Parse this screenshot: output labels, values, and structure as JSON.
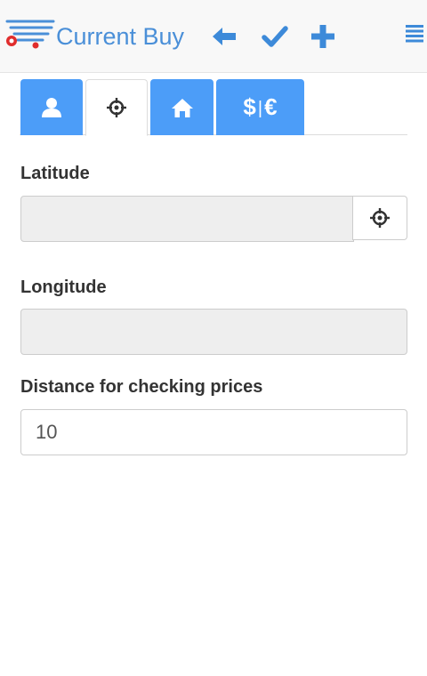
{
  "app": {
    "title": "Current Buy",
    "brand_color": "#4a8fd8"
  },
  "toolbar": {
    "icons": [
      "back-arrow-icon",
      "check-icon",
      "plus-icon",
      "menu-icon"
    ]
  },
  "tabs": [
    {
      "icon": "user-icon",
      "active": false
    },
    {
      "icon": "crosshair-icon",
      "active": true
    },
    {
      "icon": "home-icon",
      "active": false
    },
    {
      "label_left": "$",
      "label_sep": "|",
      "label_right": "€",
      "active": false
    }
  ],
  "form": {
    "latitude": {
      "label": "Latitude",
      "value": ""
    },
    "longitude": {
      "label": "Longitude",
      "value": ""
    },
    "distance": {
      "label": "Distance for checking prices",
      "value": "10"
    }
  },
  "colors": {
    "tab_blue": "#4c9df8",
    "icon_blue": "#4a8fd8",
    "disabled_input": "#eeeeee",
    "logo_red": "#e02d2d"
  }
}
